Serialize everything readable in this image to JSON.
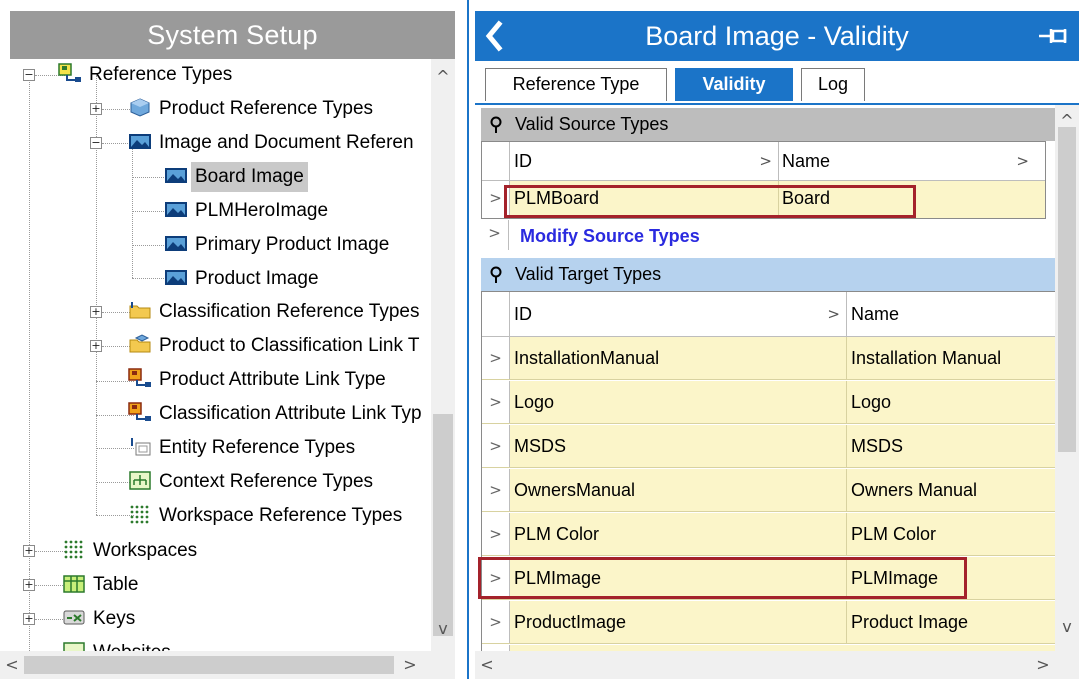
{
  "left": {
    "title": "System Setup",
    "tree": [
      {
        "label": "Reference Types",
        "expander": "−",
        "icon": "reference-types-icon"
      },
      {
        "label": "Product Reference Types",
        "expander": "+",
        "icon": "product-cube-icon"
      },
      {
        "label": "Image and Document Referen",
        "expander": "−",
        "icon": "image-folder-icon"
      },
      {
        "label": "Board Image",
        "icon": "image-icon",
        "selected": true
      },
      {
        "label": "PLMHeroImage",
        "icon": "image-icon"
      },
      {
        "label": "Primary Product Image",
        "icon": "image-icon"
      },
      {
        "label": "Product Image",
        "icon": "image-icon"
      },
      {
        "label": "Classification Reference Types",
        "expander": "+",
        "icon": "folder-icon"
      },
      {
        "label": "Product to Classification Link T",
        "expander": "+",
        "icon": "link-folder-icon"
      },
      {
        "label": "Product Attribute Link Type",
        "icon": "attribute-link-icon"
      },
      {
        "label": "Classification Attribute Link Typ",
        "icon": "attribute-link-icon"
      },
      {
        "label": "Entity Reference Types",
        "icon": "entity-reference-icon"
      },
      {
        "label": "Context Reference Types",
        "icon": "context-reference-icon"
      },
      {
        "label": "Workspace Reference Types",
        "icon": "workspace-dots-icon"
      },
      {
        "label": "Workspaces",
        "expander": "+",
        "icon": "workspace-dots-icon"
      },
      {
        "label": "Table",
        "expander": "+",
        "icon": "table-icon"
      },
      {
        "label": "Keys",
        "expander": "+",
        "icon": "keys-icon"
      },
      {
        "label": "Websites",
        "expander": "+",
        "icon": "website-icon"
      }
    ]
  },
  "right": {
    "title": "Board Image - Validity",
    "back_icon": "chevron-left-icon",
    "pin_icon": "pin-icon",
    "tabs": [
      {
        "label": "Reference Type",
        "active": false
      },
      {
        "label": "Validity",
        "active": true
      },
      {
        "label": "Log",
        "active": false
      }
    ],
    "source": {
      "title": "Valid Source Types",
      "columns": [
        "ID",
        "Name"
      ],
      "rows": [
        {
          "id": "PLMBoard",
          "name": "Board"
        }
      ],
      "modify_link": "Modify Source Types"
    },
    "target": {
      "title": "Valid Target Types",
      "columns": [
        "ID",
        "Name"
      ],
      "rows": [
        {
          "id": "InstallationManual",
          "name": "Installation Manual"
        },
        {
          "id": "Logo",
          "name": "Logo"
        },
        {
          "id": "MSDS",
          "name": "MSDS"
        },
        {
          "id": "OwnersManual",
          "name": "Owners Manual"
        },
        {
          "id": "PLM Color",
          "name": "PLM Color"
        },
        {
          "id": "PLMImage",
          "name": "PLMImage"
        },
        {
          "id": "ProductImage",
          "name": "Product Image"
        }
      ]
    }
  },
  "colors": {
    "accent_blue": "#1b74c8",
    "left_header_gray": "#9a9a9a",
    "highlight_red": "#a4222b",
    "row_yellow": "#fbf5c9",
    "target_header_blue": "#b6d2ee",
    "source_header_gray": "#bdbdbd",
    "link_blue": "#2a2adf"
  }
}
